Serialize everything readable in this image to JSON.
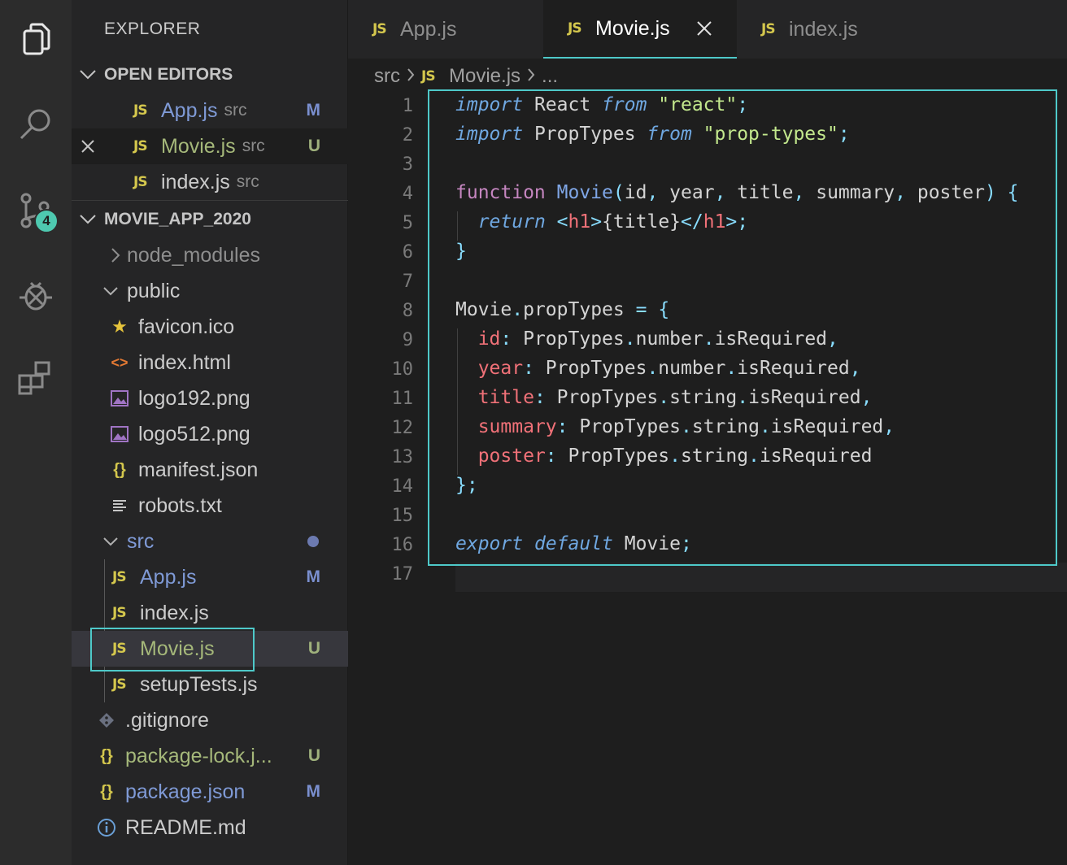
{
  "activity": {
    "icons": [
      "explorer-icon",
      "search-icon",
      "source-control-icon",
      "debug-icon",
      "extensions-icon"
    ],
    "scm_badge": "4"
  },
  "sidebar": {
    "title": "EXPLORER",
    "open_editors": {
      "header": "OPEN EDITORS",
      "items": [
        {
          "label": "App.js",
          "dir": "src",
          "status": "M"
        },
        {
          "label": "Movie.js",
          "dir": "src",
          "status": "U"
        },
        {
          "label": "index.js",
          "dir": "src",
          "status": ""
        }
      ]
    },
    "project": {
      "header": "MOVIE_APP_2020",
      "items": [
        {
          "label": "node_modules"
        },
        {
          "label": "public"
        },
        {
          "label": "favicon.ico"
        },
        {
          "label": "index.html"
        },
        {
          "label": "logo192.png"
        },
        {
          "label": "logo512.png"
        },
        {
          "label": "manifest.json"
        },
        {
          "label": "robots.txt"
        },
        {
          "label": "src"
        },
        {
          "label": "App.js",
          "status": "M"
        },
        {
          "label": "index.js"
        },
        {
          "label": "Movie.js",
          "status": "U"
        },
        {
          "label": "setupTests.js"
        },
        {
          "label": ".gitignore"
        },
        {
          "label": "package-lock.j...",
          "status": "U"
        },
        {
          "label": "package.json",
          "status": "M"
        },
        {
          "label": "README.md"
        }
      ]
    }
  },
  "tabs": [
    {
      "label": "App.js",
      "lang": "JS"
    },
    {
      "label": "Movie.js",
      "lang": "JS"
    },
    {
      "label": "index.js",
      "lang": "JS"
    }
  ],
  "breadcrumb": {
    "folder": "src",
    "file": "Movie.js",
    "more": "..."
  },
  "editor": {
    "line_numbers": [
      "1",
      "2",
      "3",
      "4",
      "5",
      "6",
      "7",
      "8",
      "9",
      "10",
      "11",
      "12",
      "13",
      "14",
      "15",
      "16",
      "17"
    ]
  },
  "colors": {
    "accent": "#4ec9c9",
    "js_badge": "#d4c74d",
    "modified": "#7a8fcf",
    "untracked": "#9fb17c"
  }
}
